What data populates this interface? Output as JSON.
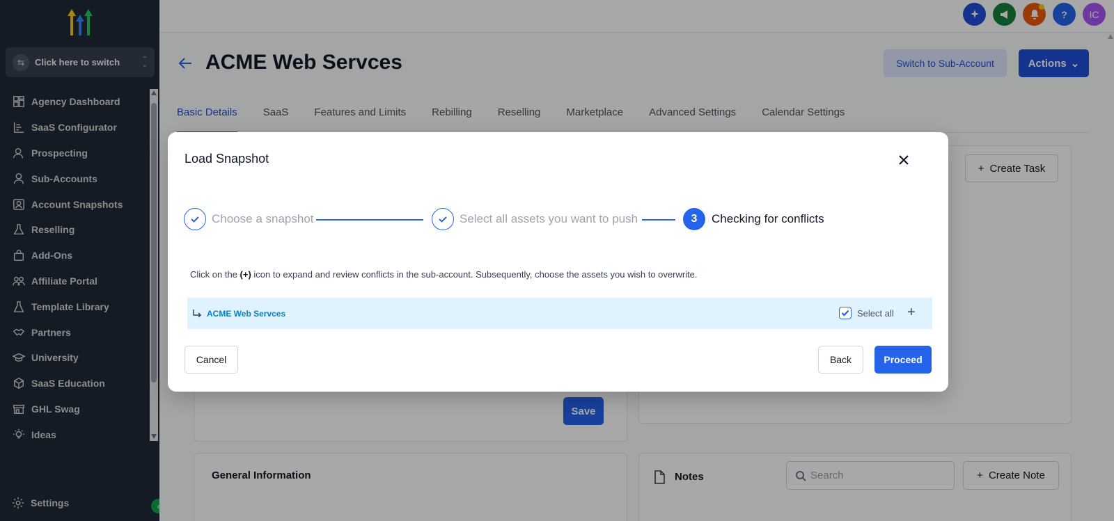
{
  "app": {
    "colors": {
      "primary": "#2563eb",
      "sidebar_bg": "#1f2937",
      "accent_green": "#16a34a"
    }
  },
  "sidebar": {
    "switcher_label": "Click here to switch",
    "items": [
      {
        "label": "Agency Dashboard",
        "icon": "dashboard-icon"
      },
      {
        "label": "SaaS Configurator",
        "icon": "chart-icon"
      },
      {
        "label": "Prospecting",
        "icon": "prospect-icon"
      },
      {
        "label": "Sub-Accounts",
        "icon": "user-icon"
      },
      {
        "label": "Account Snapshots",
        "icon": "snapshot-icon"
      },
      {
        "label": "Reselling",
        "icon": "flask-icon"
      },
      {
        "label": "Add-Ons",
        "icon": "bag-icon"
      },
      {
        "label": "Affiliate Portal",
        "icon": "users-icon"
      },
      {
        "label": "Template Library",
        "icon": "library-icon"
      },
      {
        "label": "Partners",
        "icon": "handshake-icon"
      },
      {
        "label": "University",
        "icon": "graduation-icon"
      },
      {
        "label": "SaaS Education",
        "icon": "cube-icon"
      },
      {
        "label": "GHL Swag",
        "icon": "store-icon"
      },
      {
        "label": "Ideas",
        "icon": "lightbulb-icon"
      }
    ],
    "settings_label": "Settings"
  },
  "topbar": {
    "avatar_initials": "IC",
    "icons": [
      "sparkle-icon",
      "megaphone-icon",
      "bell-icon",
      "help-icon",
      "avatar"
    ],
    "help_glyph": "?"
  },
  "page": {
    "title": "ACME Web Servces",
    "switch_button": "Switch to Sub-Account",
    "actions_button": "Actions",
    "tabs": [
      "Basic Details",
      "SaaS",
      "Features and Limits",
      "Rebilling",
      "Reselling",
      "Marketplace",
      "Advanced Settings",
      "Calendar Settings"
    ],
    "active_tab": "Basic Details",
    "create_task_button": "Create Task",
    "save_button": "Save",
    "general_info_title": "General Information",
    "notes_title": "Notes",
    "notes_search_placeholder": "Search",
    "create_note_button": "Create Note"
  },
  "modal": {
    "title": "Load Snapshot",
    "steps": [
      {
        "label": "Choose a snapshot",
        "state": "done"
      },
      {
        "label": "Select all assets you want to push",
        "state": "done"
      },
      {
        "label": "Checking for conflicts",
        "state": "current",
        "number": "3"
      }
    ],
    "instruction_pre": "Click on the ",
    "instruction_bold": "(+)",
    "instruction_post": " icon to expand and review conflicts in the sub-account. Subsequently, choose the assets you wish to overwrite.",
    "account_name": "ACME Web Servces",
    "select_all_label": "Select all",
    "select_all_checked": true,
    "expand_glyph": "+",
    "cancel_button": "Cancel",
    "back_button": "Back",
    "proceed_button": "Proceed"
  }
}
